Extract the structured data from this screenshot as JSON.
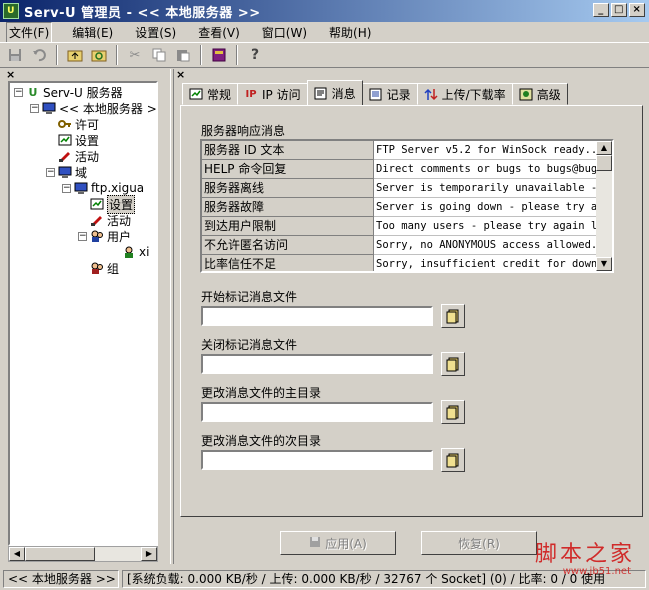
{
  "window": {
    "title": "Serv-U 管理员 - << 本地服务器 >>",
    "app_icon": "serv-u-icon",
    "buttons": [
      "_",
      "□",
      "×"
    ]
  },
  "menu": [
    {
      "label": "文件(F)"
    },
    {
      "label": "编辑(E)"
    },
    {
      "label": "设置(S)"
    },
    {
      "label": "查看(V)"
    },
    {
      "label": "窗口(W)"
    },
    {
      "label": "帮助(H)"
    }
  ],
  "toolbar": {
    "icons": [
      "save-icon",
      "undo-icon",
      "folder-up-icon",
      "refresh-icon",
      "cut-icon",
      "copy-icon",
      "paste-icon",
      "book-icon",
      "help-icon"
    ]
  },
  "tree": {
    "nodes": [
      {
        "label": "Serv-U 服务器",
        "icon": "serv-u-icon"
      },
      {
        "label": "<< 本地服务器 >>",
        "icon": "computer-icon"
      },
      {
        "label": "许可",
        "icon": "key-icon"
      },
      {
        "label": "设置",
        "icon": "settings-icon"
      },
      {
        "label": "活动",
        "icon": "activity-icon"
      },
      {
        "label": "域",
        "icon": "domain-icon"
      },
      {
        "label": "ftp.xigua",
        "icon": "computer-icon"
      },
      {
        "label": "设置",
        "icon": "settings-icon"
      },
      {
        "label": "活动",
        "icon": "activity-icon"
      },
      {
        "label": "用户",
        "icon": "users-icon"
      },
      {
        "label": "xi",
        "icon": "user-icon"
      },
      {
        "label": "组",
        "icon": "group-icon"
      }
    ]
  },
  "tabs": [
    {
      "label": "常规",
      "icon": "general-icon"
    },
    {
      "label": "IP 访问",
      "icon": "ip-icon"
    },
    {
      "label": "消息",
      "icon": "message-icon",
      "active": true
    },
    {
      "label": "记录",
      "icon": "log-icon"
    },
    {
      "label": "上传/下载率",
      "icon": "ratio-icon"
    },
    {
      "label": "高级",
      "icon": "advanced-icon"
    }
  ],
  "messages": {
    "section_label": "服务器响应消息",
    "rows": [
      {
        "key": "服务器 ID 文本",
        "value": "FTP Server v5.2 for WinSock ready..."
      },
      {
        "key": "HELP 命令回复",
        "value": "Direct comments or bugs to bugs@bugs.com"
      },
      {
        "key": "服务器离线",
        "value": "Server is temporarily unavailable - please"
      },
      {
        "key": "服务器故障",
        "value": "Server is going down - please try again"
      },
      {
        "key": "到达用户限制",
        "value": "Too many users - please try again later"
      },
      {
        "key": "不允许匿名访问",
        "value": "Sorry, no ANONYMOUS access allowed."
      },
      {
        "key": "比率信任不足",
        "value": "Sorry, insufficient credit for download"
      }
    ]
  },
  "file_fields": [
    {
      "label": "开始标记消息文件",
      "value": ""
    },
    {
      "label": "关闭标记消息文件",
      "value": ""
    },
    {
      "label": "更改消息文件的主目录",
      "value": ""
    },
    {
      "label": "更改消息文件的次目录",
      "value": ""
    }
  ],
  "buttons": {
    "apply": "应用(A)",
    "restore": "恢复(R)"
  },
  "status": {
    "server": "<< 本地服务器 >>",
    "stats": "[系统负载: 0.000 KB/秒 / 上传: 0.000 KB/秒 / 32767 个 Socket] (0) / 比率: 0 / 0 使用"
  },
  "watermark": {
    "text": "脚本之家",
    "url": "www.jb51.net"
  }
}
